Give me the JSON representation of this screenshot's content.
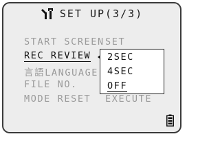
{
  "header": {
    "title": "SET UP(3/3)",
    "icon": "wrench-setup-icon"
  },
  "menu": {
    "items": [
      {
        "label": "START SCREEN",
        "value": "SET"
      },
      {
        "label": "REC REVIEW",
        "value": ""
      },
      {
        "label": "言語LANGUAGE",
        "value": ""
      },
      {
        "label": "FILE NO.",
        "value": ""
      },
      {
        "label": "MODE RESET",
        "value": "EXECUTE"
      }
    ],
    "active_index": 1
  },
  "selector": {
    "options": [
      "2SEC",
      "4SEC",
      "OFF"
    ],
    "highlighted": "2SEC",
    "current": "OFF"
  },
  "status": {
    "battery_icon": "battery-full-icon"
  },
  "colors": {
    "screen_bg": "#ededed",
    "active_text": "#111111",
    "inactive_text": "#9a9a9a"
  }
}
